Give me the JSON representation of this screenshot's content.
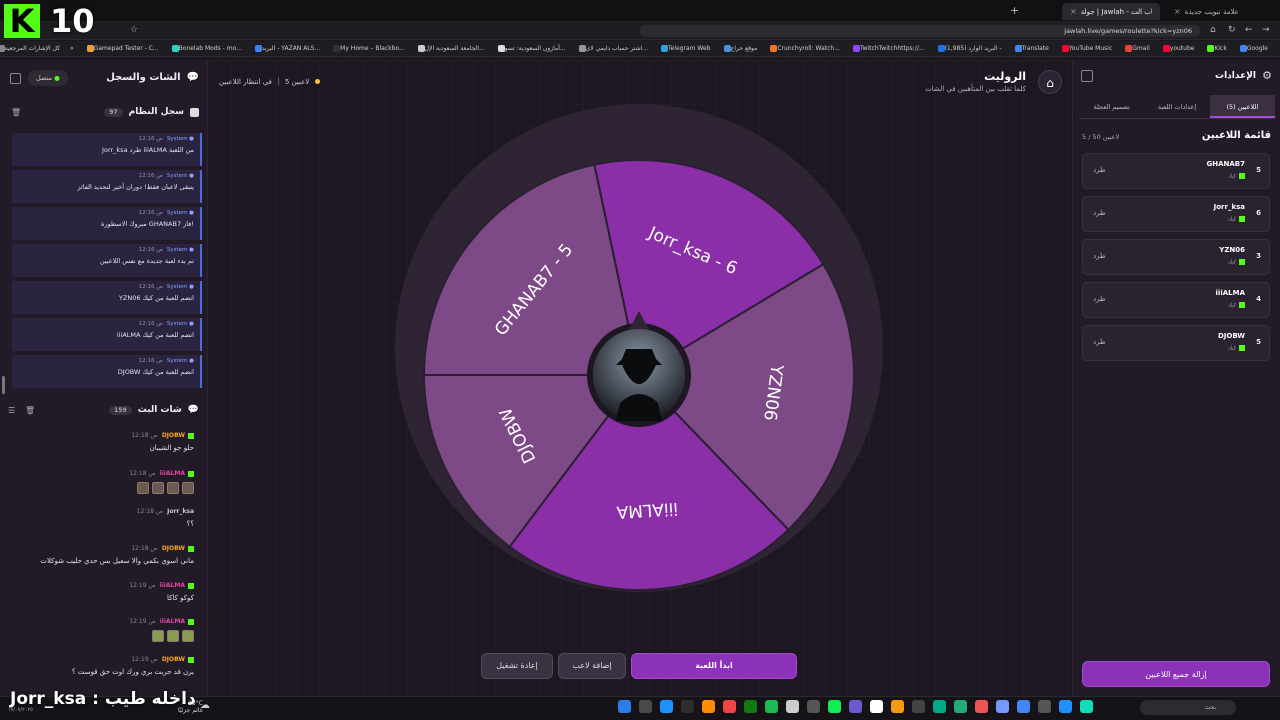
{
  "browser": {
    "tabs": [
      {
        "label": "علامة تبويب جديدة"
      },
      {
        "label": "جولة | Jawlah - منصة الألعاب الت..."
      }
    ],
    "url": "jawlah.live/games/roulette?kick=yzn06",
    "bookmarks": [
      "Google",
      "Kick",
      "youtube",
      "Gmail",
      "YouTube Music",
      "Translate",
      "البريد الوارد (1,985) -",
      "TwitchTwitchhttps://...",
      "Crunchyroll: Watch...",
      "موقع حراج",
      "Telegram Web",
      "اشتر حساب دايمي لاي...",
      "أمازون السعودية: تسو...",
      "الجامعة السعودية الإل...",
      "My Home – Blackbo...",
      "البريد - YAZAN ALS...",
      "Bonelab Mods - mo...",
      "Gamepad Tester - C..."
    ],
    "bookmarks_all": "كل الإشارات المرجعية"
  },
  "overlay": {
    "kick_logo": "K",
    "viewer_count": "10",
    "bottom_text": "Jorr_ksa : داخله طيب"
  },
  "chat_panel": {
    "title": "الشات والسجل",
    "status": "متصل",
    "log_title": "سجل النظام",
    "log_count": "97",
    "system_messages": [
      {
        "user": "System",
        "time": "12:16 ص",
        "text": "Jorr_ksa طرد iiiALMA من اللعبة"
      },
      {
        "user": "System",
        "time": "12:16 ص",
        "text": "يتبقى لاعبان فقط! دوران أخير لتحديد الفائز"
      },
      {
        "user": "System",
        "time": "12:16 ص",
        "text": "مبروك الاسطورة GHANAB7 فاز!"
      },
      {
        "user": "System",
        "time": "12:16 ص",
        "text": "تم بدء لعبة جديدة مع نفس اللاعبين"
      },
      {
        "user": "System",
        "time": "12:16 ص",
        "text": "YZN06 انضم للعبة من كيك"
      },
      {
        "user": "System",
        "time": "12:16 ص",
        "text": "iiiALMA انضم للعبة من كيك"
      },
      {
        "user": "System",
        "time": "12:16 ص",
        "text": "DJOBW انضم للعبة من كيك"
      }
    ],
    "live_title": "شات البث",
    "live_count": "159",
    "messages": [
      {
        "user": "DJOBW",
        "time": "12:18 ص",
        "text": "حلو جو الشيبان",
        "color": "#f5a623"
      },
      {
        "user": "iiiALMA",
        "time": "12:18 ص",
        "text": "",
        "color": "#e0479e"
      },
      {
        "user": "Jorr_ksa",
        "time": "12:18 ص",
        "text": "؟؟",
        "color": "#cccccc"
      },
      {
        "user": "DJOBW",
        "time": "12:18 ص",
        "text": "ماني اسوي بكمي والا سعيل بس حدي حليب شوكلات",
        "color": "#f5a623"
      },
      {
        "user": "iiiALMA",
        "time": "12:19 ص",
        "text": "كوكو كاكا",
        "color": "#e0479e"
      },
      {
        "user": "iiiALMA",
        "time": "12:19 ص",
        "text": "",
        "color": "#e0479e"
      },
      {
        "user": "DJOBW",
        "time": "12:19 ص",
        "text": "يزن قد جربت بري ورك اوت حق قوست ؟",
        "color": "#f5a623"
      }
    ]
  },
  "game": {
    "title": "الروليت",
    "subtitle": "كلما تقلب بين المتأهبين في الشات",
    "players_count": "5 لاعبين",
    "waiting": "في انتظار اللاعبين",
    "home_icon": "home-icon",
    "buttons": {
      "start": "ابدأ اللعبة",
      "add": "إضافة لاعب",
      "restart": "إعادة تشغيل"
    },
    "wheel": {
      "segments": [
        {
          "label": "Jorr_ksa - 6",
          "color": "#8a2fa8"
        },
        {
          "label": "YZN06",
          "color": "#7d4a87"
        },
        {
          "label": "iiiALMA",
          "color": "#8a2fa8"
        },
        {
          "label": "DJOBW",
          "color": "#7d4a87"
        },
        {
          "label": "GHANAB7 - 5",
          "color": "#7d4a87"
        }
      ],
      "rim_color": "#2e2434",
      "accent": "#8b32b8"
    }
  },
  "settings_panel": {
    "title": "الإعدادات",
    "tabs": [
      "اللاعبين (5)",
      "إعدادات اللعبة",
      "تصميم العجلة"
    ],
    "list_title": "قائمة اللاعبين",
    "list_count": "5 / 50 لاعبين",
    "kick_label": "طرد",
    "players": [
      {
        "num": "5",
        "name": "GHANAB7",
        "source": "كيك"
      },
      {
        "num": "6",
        "name": "Jorr_ksa",
        "source": "كيك"
      },
      {
        "num": "3",
        "name": "YZN06",
        "source": "كيك"
      },
      {
        "num": "4",
        "name": "iiiALMA",
        "source": "كيك"
      },
      {
        "num": "5",
        "name": "DJOBW",
        "source": "كيك"
      }
    ],
    "remove_all": "إزالة جميع اللاعبين"
  },
  "taskbar": {
    "weather_temp": "23°C",
    "weather_text": "غائم جزئيًا",
    "search": "بحث",
    "date": "١٧/٠٧/٢٠٢٥"
  }
}
